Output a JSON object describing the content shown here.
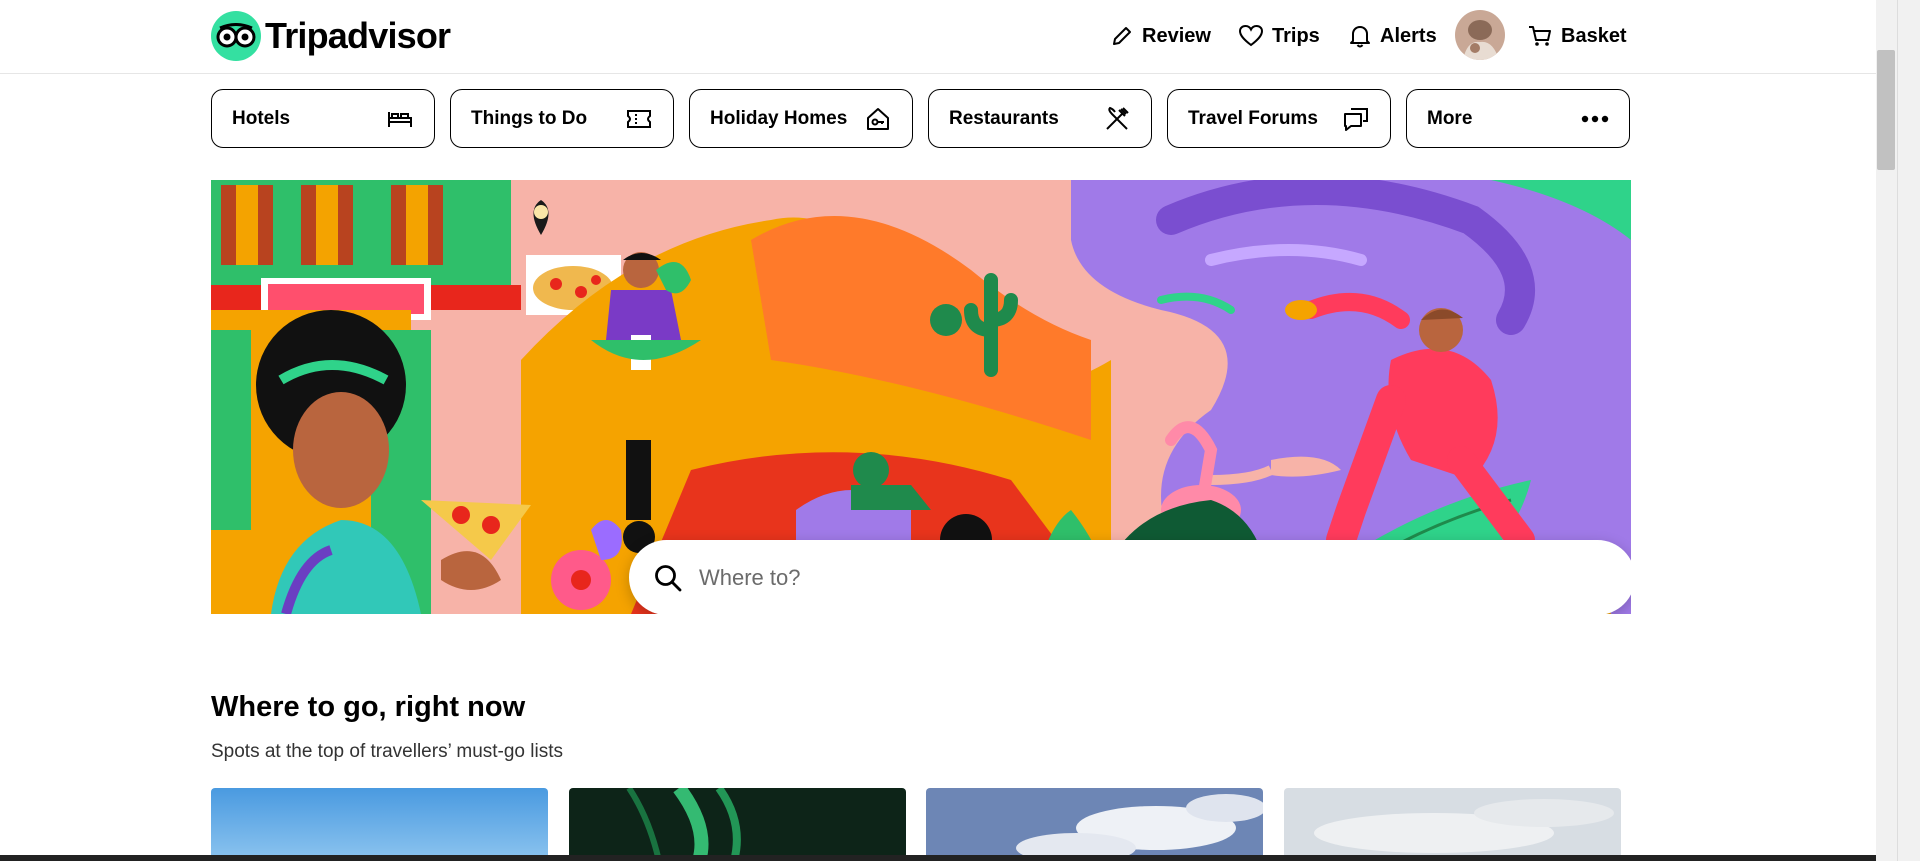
{
  "header": {
    "logo_text": "Tripadvisor",
    "nav": {
      "review": "Review",
      "trips": "Trips",
      "alerts": "Alerts",
      "basket": "Basket"
    }
  },
  "categories": [
    {
      "label": "Hotels",
      "icon": "bed-icon"
    },
    {
      "label": "Things to Do",
      "icon": "ticket-icon"
    },
    {
      "label": "Holiday Homes",
      "icon": "house-key-icon"
    },
    {
      "label": "Restaurants",
      "icon": "fork-knife-icon"
    },
    {
      "label": "Travel Forums",
      "icon": "chat-bubbles-icon"
    },
    {
      "label": "More",
      "icon": "more-dots-icon"
    }
  ],
  "search": {
    "placeholder": "Where to?"
  },
  "section": {
    "title": "Where to go, right now",
    "subtitle": "Spots at the top of travellers’ must-go lists"
  },
  "colors": {
    "brand": "#34e0a1",
    "text": "#000000"
  }
}
